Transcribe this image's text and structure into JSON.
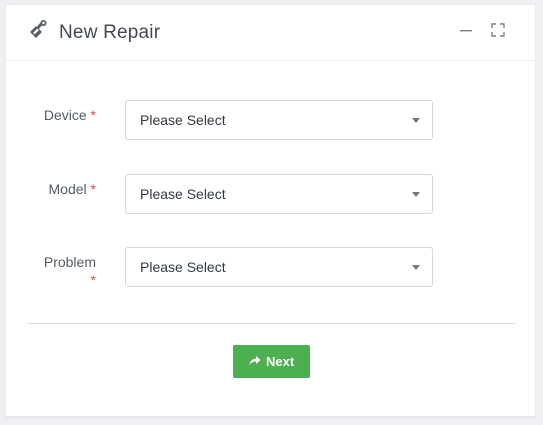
{
  "header": {
    "title": "New Repair",
    "icon": "repair-tools-icon",
    "minimize_icon": "minimize-icon",
    "fullscreen_icon": "fullscreen-icon"
  },
  "form": {
    "device": {
      "label": "Device",
      "required_mark": "*",
      "value": "Please Select"
    },
    "model": {
      "label": "Model",
      "required_mark": "*",
      "value": "Please Select"
    },
    "problem": {
      "label": "Problem",
      "required_mark": "*",
      "value": "Please Select"
    }
  },
  "actions": {
    "next_label": "Next",
    "next_icon": "share-arrow-icon",
    "next_color": "#4caf50"
  },
  "colors": {
    "required": "#e0474c",
    "title": "#444a52"
  }
}
